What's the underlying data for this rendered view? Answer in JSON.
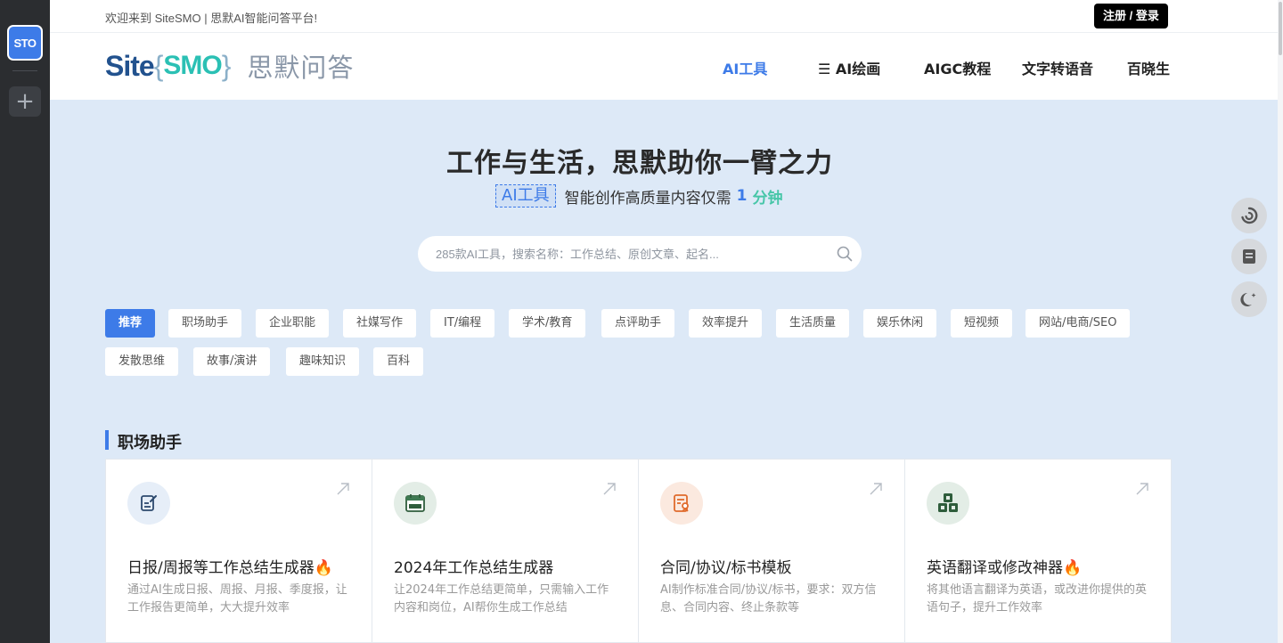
{
  "rail": {
    "app_label": "STO",
    "add_label": "+"
  },
  "topbar": {
    "welcome": "欢迎来到 SiteSMO | 思默AI智能问答平台!",
    "login_button": "注册 / 登录"
  },
  "header": {
    "logo": {
      "site": "Site",
      "brace_open": "{",
      "smo": "SMO",
      "brace_close": "}",
      "cn": "思默问答"
    },
    "nav": [
      {
        "label": "AI工具",
        "active": true
      },
      {
        "label": "☰ AI绘画",
        "active": false
      },
      {
        "label": "AIGC教程",
        "active": false
      },
      {
        "label": "文字转语音",
        "active": false
      },
      {
        "label": "百晓生",
        "active": false
      }
    ]
  },
  "hero": {
    "title": "工作与生活，思默助你一臂之力",
    "tag": "AI工具",
    "subtitle": "智能创作高质量内容仅需",
    "num": "1",
    "unit": "分钟"
  },
  "search": {
    "placeholder": "285款AI工具，搜索名称：工作总结、原创文章、起名..."
  },
  "categories": [
    {
      "label": "推荐",
      "active": true
    },
    {
      "label": "职场助手",
      "active": false
    },
    {
      "label": "企业职能",
      "active": false
    },
    {
      "label": "社媒写作",
      "active": false
    },
    {
      "label": "IT/编程",
      "active": false
    },
    {
      "label": "学术/教育",
      "active": false
    },
    {
      "label": "点评助手",
      "active": false
    },
    {
      "label": "效率提升",
      "active": false
    },
    {
      "label": "生活质量",
      "active": false
    },
    {
      "label": "娱乐休闲",
      "active": false
    },
    {
      "label": "短视频",
      "active": false
    },
    {
      "label": "网站/电商/SEO",
      "active": false
    },
    {
      "label": "发散思维",
      "active": false
    },
    {
      "label": "故事/演讲",
      "active": false
    },
    {
      "label": "趣味知识",
      "active": false
    },
    {
      "label": "百科",
      "active": false
    }
  ],
  "section": {
    "title": "职场助手"
  },
  "cards": [
    {
      "title": "日报/周报等工作总结生成器🔥",
      "desc": "通过AI生成日报、周报、月报、季度报，让工作报告更简单，大大提升效率",
      "icon": "edit-note-icon"
    },
    {
      "title": "2024年工作总结生成器",
      "desc": "让2024年工作总结更简单，只需输入工作内容和岗位，AI帮你生成工作总结",
      "icon": "calendar-2024-icon"
    },
    {
      "title": "合同/协议/标书模板",
      "desc": "AI制作标准合同/协议/标书，要求：双方信息、合同内容、终止条款等",
      "icon": "contract-icon"
    },
    {
      "title": "英语翻译或修改神器🔥",
      "desc": "将其他语言翻译为英语，或改进你提供的英语句子，提升工作效率",
      "icon": "abc-blocks-icon"
    }
  ],
  "colors": {
    "accent": "#3d7be8",
    "page_bg": "#dde9f7",
    "rail_bg": "#2b2d30"
  }
}
